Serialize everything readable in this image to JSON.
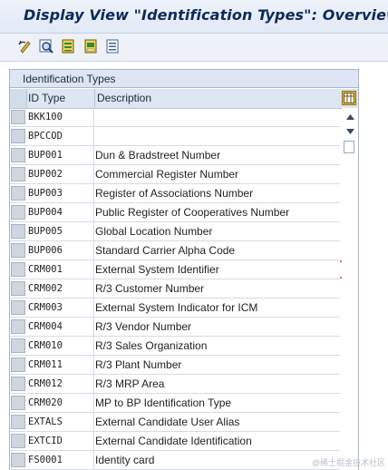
{
  "window": {
    "title": "Display View \"Identification Types\": Overview"
  },
  "toolbar": {
    "buttons": [
      {
        "icon": "display-change-icon"
      },
      {
        "icon": "details-icon"
      },
      {
        "icon": "select-all-icon"
      },
      {
        "icon": "select-block-icon"
      },
      {
        "icon": "deselect-all-icon"
      }
    ]
  },
  "table": {
    "title": "Identification Types",
    "columns": {
      "id": "ID Type",
      "desc": "Description"
    },
    "rows": [
      {
        "id": "BKK100",
        "desc": ""
      },
      {
        "id": "BPCCOD",
        "desc": ""
      },
      {
        "id": "BUP001",
        "desc": "Dun & Bradstreet Number"
      },
      {
        "id": "BUP002",
        "desc": "Commercial Register Number"
      },
      {
        "id": "BUP003",
        "desc": "Register of Associations Number"
      },
      {
        "id": "BUP004",
        "desc": "Public Register of Cooperatives Number"
      },
      {
        "id": "BUP005",
        "desc": "Global Location Number"
      },
      {
        "id": "BUP006",
        "desc": "Standard Carrier Alpha Code"
      },
      {
        "id": "CRM001",
        "desc": "External System Identifier"
      },
      {
        "id": "CRM002",
        "desc": "R/3 Customer Number"
      },
      {
        "id": "CRM003",
        "desc": "External System Indicator for ICM"
      },
      {
        "id": "CRM004",
        "desc": "R/3 Vendor Number"
      },
      {
        "id": "CRM010",
        "desc": "R/3 Sales Organization"
      },
      {
        "id": "CRM011",
        "desc": "R/3 Plant Number"
      },
      {
        "id": "CRM012",
        "desc": "R/3 MRP Area"
      },
      {
        "id": "CRM020",
        "desc": "MP to BP Identification Type"
      },
      {
        "id": "EXTALS",
        "desc": "External Candidate User Alias"
      },
      {
        "id": "EXTCID",
        "desc": "External Candidate Identification"
      },
      {
        "id": "FS0001",
        "desc": "Identity card"
      }
    ]
  },
  "watermark": "@稀土掘金技术社区",
  "colors": {
    "title": "#0b2a5b",
    "panel_header": "#dde6f2",
    "focus_marker": "#d0021b"
  }
}
